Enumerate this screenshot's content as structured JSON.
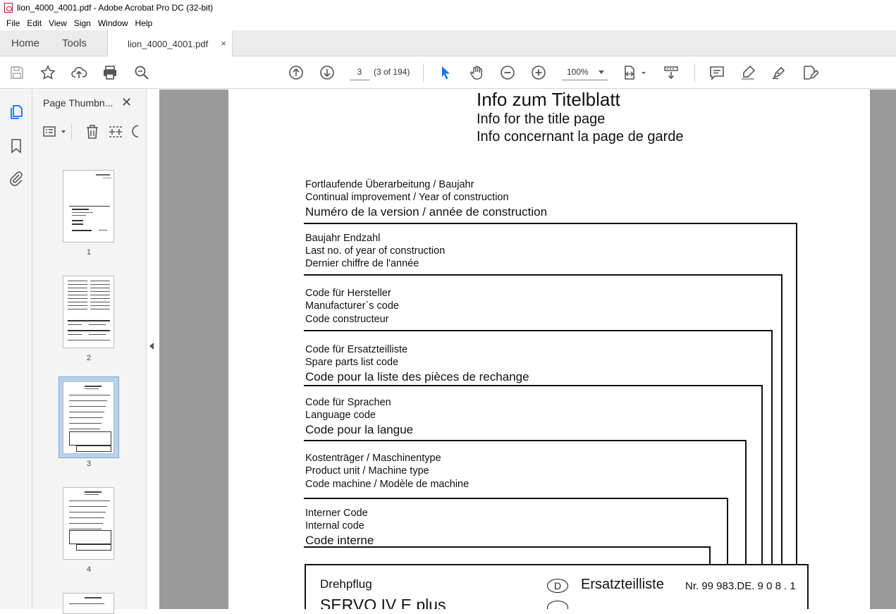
{
  "window": {
    "title": "lion_4000_4001.pdf - Adobe Acrobat Pro DC (32-bit)"
  },
  "menu": [
    "File",
    "Edit",
    "View",
    "Sign",
    "Window",
    "Help"
  ],
  "tabs": {
    "home": "Home",
    "tools": "Tools",
    "document": "lion_4000_4001.pdf",
    "close": "×"
  },
  "toolbar": {
    "page_current": "3",
    "page_count": "(3 of 194)",
    "zoom": "100%"
  },
  "panel": {
    "title": "Page Thumbn...",
    "close": "✕",
    "thumbnails": [
      "1",
      "2",
      "3",
      "4"
    ]
  },
  "document": {
    "heading": [
      "Info  zum  Titelblatt",
      "Info for the title page",
      "Info concernant la page de garde"
    ],
    "groups": [
      [
        "Fortlaufende Überarbeitung / Baujahr",
        "Continual improvement / Year of construction",
        "Numéro de la version / année de construction"
      ],
      [
        "Baujahr Endzahl",
        "Last no. of year of construction",
        "Dernier chiffre de l'année"
      ],
      [
        "Code für Hersteller",
        "Manufacturer`s  code",
        "Code constructeur"
      ],
      [
        "Code für Ersatzteilliste",
        "Spare parts list code",
        "Code pour la liste des pièces de rechange"
      ],
      [
        "Code für Sprachen",
        "Language code",
        "Code pour la langue"
      ],
      [
        "Kostenträger / Maschinentype",
        "Product unit / Machine type",
        "Code machine / Modèle de machine"
      ],
      [
        "Interner Code",
        "Internal code",
        "Code interne"
      ]
    ],
    "box": {
      "product": "Drehpflug",
      "model": "SERVO IV E plus",
      "lang_marker": "D",
      "list_title": "Ersatzteilliste",
      "number": "Nr. 99 983.DE. 9 0 8 . 1"
    }
  },
  "colors": {
    "accent": "#1473e6",
    "viewer_bg": "#9a9a9a",
    "panel_bg": "#f4f4f4"
  }
}
